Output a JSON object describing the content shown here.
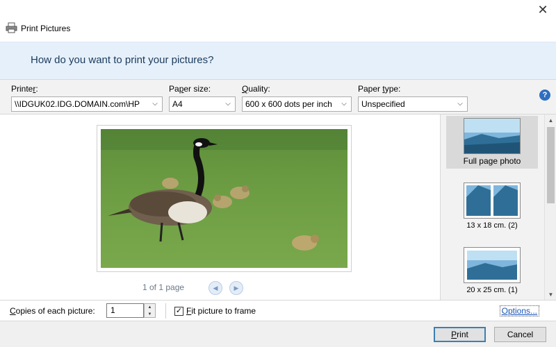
{
  "window": {
    "title": "Print Pictures"
  },
  "header": {
    "question": "How do you want to print your pictures?"
  },
  "options": {
    "printer": {
      "label_pre": "Printe",
      "label_key": "r",
      "label_post": ":",
      "value": "\\\\IDGUK02.IDG.DOMAIN.com\\HP"
    },
    "paper_size": {
      "label_pre": "Pa",
      "label_key": "p",
      "label_post": "er size:",
      "value": "A4"
    },
    "quality": {
      "label_pre": "",
      "label_key": "Q",
      "label_post": "uality:",
      "value": "600 x 600 dots per inch"
    },
    "paper_type": {
      "label_pre": "Paper ",
      "label_key": "t",
      "label_post": "ype:",
      "value": "Unspecified"
    }
  },
  "preview": {
    "pager": "1 of 1 page"
  },
  "layouts": [
    {
      "label": "Full page photo",
      "selected": true
    },
    {
      "label": "13 x 18 cm. (2)",
      "selected": false
    },
    {
      "label": "20 x 25 cm. (1)",
      "selected": false
    }
  ],
  "bottom": {
    "copies_label_key": "C",
    "copies_label_rest": "opies of each picture:",
    "copies_value": "1",
    "fit_checked": true,
    "fit_label_key": "F",
    "fit_label_rest": "it picture to frame",
    "options_link": "Options..."
  },
  "buttons": {
    "print_key": "P",
    "print_rest": "rint",
    "cancel": "Cancel"
  },
  "colors": {
    "header_bg": "#e6f0fa",
    "accent": "#3c7fb1",
    "link": "#1a56b8"
  }
}
